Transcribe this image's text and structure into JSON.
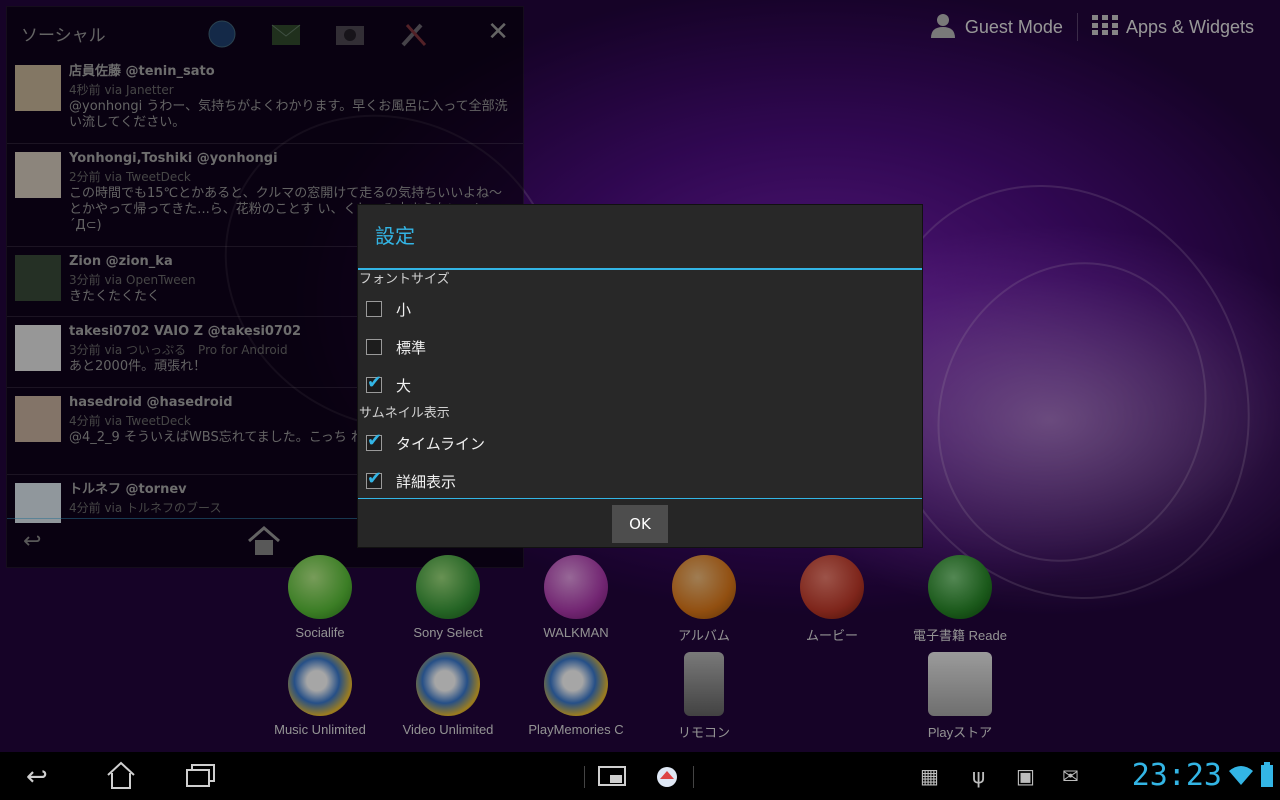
{
  "topbar": {
    "guest_mode": "Guest Mode",
    "apps_widgets": "Apps & Widgets"
  },
  "widget": {
    "title": "ソーシャル",
    "tweets": [
      {
        "user": "店員佐藤 @tenin_sato",
        "meta": "4秒前 via Janetter",
        "text": "@yonhongi うわー、気持ちがよくわかります。早くお風呂に入って全部洗い流してください。"
      },
      {
        "user": "Yonhongi,Toshiki @yonhongi",
        "meta": "2分前 via TweetDeck",
        "text": "この時間でも15℃とかあると、クルマの窓開けて走るの気持ちいいよね〜とかやって帰ってきた...ら、花粉のことす い、くしゃみ止まらない〜(。´Д⊂)"
      },
      {
        "user": "Zion @zion_ka",
        "meta": "3分前 via OpenTween",
        "text": "きたくたくたく"
      },
      {
        "user": "takesi0702 VAIO Z @takesi0702",
        "meta": "3分前 via ついっぷる　Pro for Android",
        "text": "あと2000件。頑張れ！"
      },
      {
        "user": "hasedroid @hasedroid",
        "meta": "4分前 via TweetDeck",
        "text": "@4_2_9 そういえばWBS忘れてました。こっち ね。"
      },
      {
        "user": "トルネフ @tornev",
        "meta": "4分前 via トルネフのブース",
        "text": ""
      }
    ]
  },
  "apps_row1": [
    {
      "label": "Socialife",
      "color": "#5cc23a"
    },
    {
      "label": "Sony Select",
      "color": "#3a9c3a"
    },
    {
      "label": "WALKMAN",
      "color": "#b03ab0"
    },
    {
      "label": "アルバム",
      "color": "#e07a1a"
    },
    {
      "label": "ムービー",
      "color": "#c23a2a"
    },
    {
      "label": "電子書籍 Reade",
      "color": "#2a8a2a"
    }
  ],
  "apps_row2": [
    {
      "label": "Music Unlimited",
      "color": "#3a7ad0"
    },
    {
      "label": "Video Unlimited",
      "color": "#3a7ad0"
    },
    {
      "label": "PlayMemories C",
      "color": "#3a7ad0"
    },
    {
      "label": "リモコン",
      "color": "#8a8a8a"
    },
    {
      "label": "Playストア",
      "color": "#cfcfcf"
    }
  ],
  "dialog": {
    "title": "設定",
    "font_size_section": "フォントサイズ",
    "font_size_options": [
      {
        "label": "小",
        "checked": false
      },
      {
        "label": "標準",
        "checked": false
      },
      {
        "label": "大",
        "checked": true
      }
    ],
    "thumbnail_section": "サムネイル表示",
    "thumbnail_options": [
      {
        "label": "タイムライン",
        "checked": true
      },
      {
        "label": "詳細表示",
        "checked": true
      }
    ],
    "ok_label": "OK"
  },
  "system_bar": {
    "clock": "23:23"
  },
  "colors": {
    "accent": "#33b5e5"
  }
}
